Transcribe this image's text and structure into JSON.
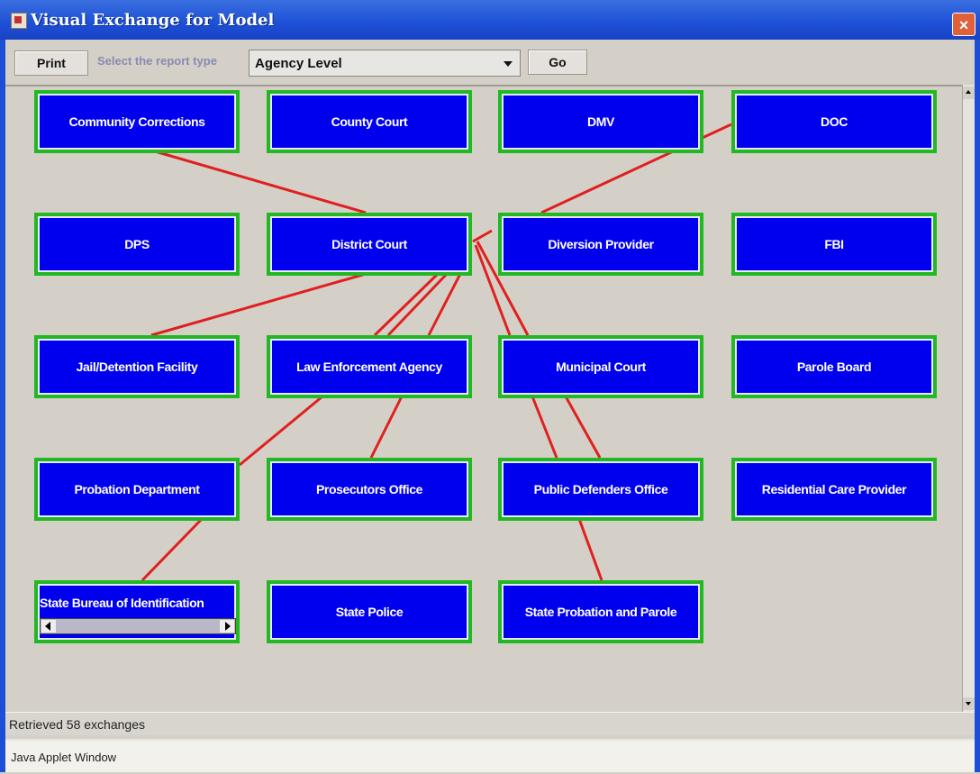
{
  "window": {
    "title": "Visual Exchange for Model",
    "close_glyph": "×"
  },
  "toolbar": {
    "print_label": "Print",
    "select_label": "Select the report type",
    "report_type_value": "Agency Level",
    "go_label": "Go"
  },
  "nodes": [
    "Community Corrections",
    "County Court",
    "DMV",
    "DOC",
    "DPS",
    "District Court",
    "Diversion Provider",
    "FBI",
    "Jail/Detention Facility",
    "Law Enforcement Agency",
    "Municipal Court",
    "Parole Board",
    "Probation Department",
    "Prosecutors Office",
    "Public Defenders Office",
    "Residential Care Provider",
    "State Bureau of Identification",
    "State Police",
    "State Probation and Parole"
  ],
  "status": "Retrieved 58 exchanges",
  "applet_label": "Java Applet Window",
  "colors": {
    "node_fill": "#0000ee",
    "node_border": "#21b821",
    "link": "#e02020",
    "title_bar": "#1d4fd6"
  },
  "icons": [
    "java-applet-icon",
    "close-icon",
    "dropdown-arrow-icon",
    "scroll-up-icon",
    "scroll-down-icon"
  ]
}
